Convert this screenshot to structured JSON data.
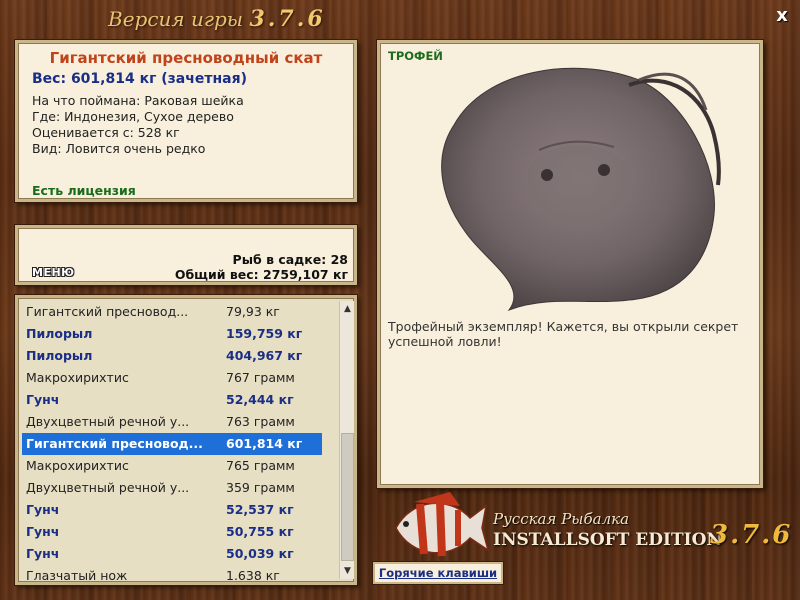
{
  "window": {
    "title_prefix": "Версия игры",
    "title_version": "3.7.6",
    "close_glyph": "x"
  },
  "fish_info": {
    "name": "Гигантский пресноводный скат",
    "weight": "Вес: 601,814 кг (зачетная)",
    "lines": [
      "На что поймана: Раковая шейка",
      "Где: Индонезия, Сухое дерево",
      "Оценивается с: 528 кг",
      "Вид: Ловится очень редко"
    ],
    "license": "Есть лицензия"
  },
  "cage": {
    "count": "Рыб в садке: 28",
    "total": "Общий вес: 2759,107 кг",
    "menu_label": "МЕНЮ"
  },
  "catch_list": [
    {
      "name": "Гигантский пресновод...",
      "weight": "79,93 кг",
      "style": "normal"
    },
    {
      "name": "Пилорыл",
      "weight": "159,759 кг",
      "style": "bold"
    },
    {
      "name": "Пилорыл",
      "weight": "404,967 кг",
      "style": "bold"
    },
    {
      "name": "Макрохирихтис",
      "weight": "767 грамм",
      "style": "normal"
    },
    {
      "name": "Гунч",
      "weight": "52,444 кг",
      "style": "bold"
    },
    {
      "name": "Двухцветный речной у...",
      "weight": "763 грамм",
      "style": "normal"
    },
    {
      "name": "Гигантский пресновод...",
      "weight": "601,814 кг",
      "style": "selected"
    },
    {
      "name": "Макрохирихтис",
      "weight": "765 грамм",
      "style": "normal"
    },
    {
      "name": "Двухцветный речной у...",
      "weight": "359 грамм",
      "style": "normal"
    },
    {
      "name": "Гунч",
      "weight": "52,537 кг",
      "style": "bold"
    },
    {
      "name": "Гунч",
      "weight": "50,755 кг",
      "style": "bold"
    },
    {
      "name": "Гунч",
      "weight": "50,039 кг",
      "style": "bold"
    },
    {
      "name": "Глазчатый нож",
      "weight": "1.638 кг",
      "style": "normal"
    }
  ],
  "trophy": {
    "label": "ТРОФЕЙ",
    "description": "Трофейный экземпляр! Кажется, вы открыли секрет успешной ловли!"
  },
  "brand": {
    "line1": "Русская Рыбалка",
    "line2": "INSTALLSOFT EDITION",
    "version": "3.7.6"
  },
  "hotkeys_label": "Горячие клавиши",
  "colors": {
    "accent_red": "#c0431b",
    "bold_blue": "#1b2e86",
    "license_green": "#1a6b1a",
    "selection": "#1f6fd8"
  }
}
